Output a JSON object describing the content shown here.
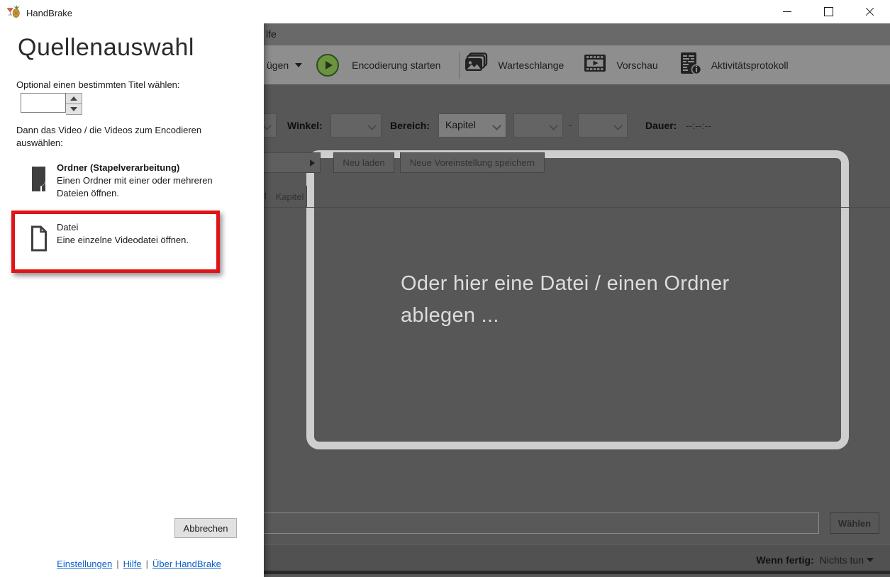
{
  "window": {
    "title": "HandBrake",
    "controls": {
      "minimize": "minimize",
      "maximize": "maximize",
      "close": "close"
    }
  },
  "dialog": {
    "title": "Quellenauswahl",
    "title_hint": "Optional einen bestimmten Titel wählen:",
    "spinner_value": "",
    "instruction": "Dann das Video / die Videos zum Encodieren auswählen:",
    "options": [
      {
        "label": "Ordner (Stapelverarbeitung)",
        "description": "Einen Ordner mit einer oder mehreren Dateien öffnen.",
        "icon": "folder-batch-icon",
        "highlighted": false
      },
      {
        "label": "Datei",
        "description": "Eine einzelne Videodatei öffnen.",
        "icon": "file-icon",
        "highlighted": true
      }
    ],
    "highlight_color": "#df1418",
    "cancel_label": "Abbrechen",
    "footer_links": [
      "Einstellungen",
      "Hilfe",
      "Über HandBrake"
    ],
    "footer_separator": "|"
  },
  "main": {
    "menu_fragment": "lfe",
    "toolbar": {
      "add_source_fragment": "ügen",
      "start_label": "Encodierung starten",
      "start_button_color": "#6b9440",
      "queue_label": "Warteschlange",
      "preview_label": "Vorschau",
      "activity_label": "Aktivitätsprotokoll"
    },
    "source_row": {
      "winkel_label": "Winkel:",
      "winkel_value": "",
      "bereich_label": "Bereich:",
      "bereich_value": "Kapitel",
      "range_from_value": "",
      "range_separator": "-",
      "range_to_value": "",
      "dauer_label": "Dauer:",
      "dauer_value": "--:--:--"
    },
    "preset_row": {
      "reload_label": "Neu laden",
      "save_label": "Neue Voreinstellung speichern"
    },
    "tabs": {
      "fragment": "l",
      "kapitel_label": "Kapitel"
    },
    "dropzone": {
      "message_line1": "Oder hier eine Datei / einen Ordner",
      "message_line2": "ablegen ..."
    },
    "bottom": {
      "path_value": "",
      "choose_label": "Wählen"
    },
    "statusbar": {
      "when_done_label": "Wenn fertig:",
      "when_done_value": "Nichts tun"
    }
  }
}
